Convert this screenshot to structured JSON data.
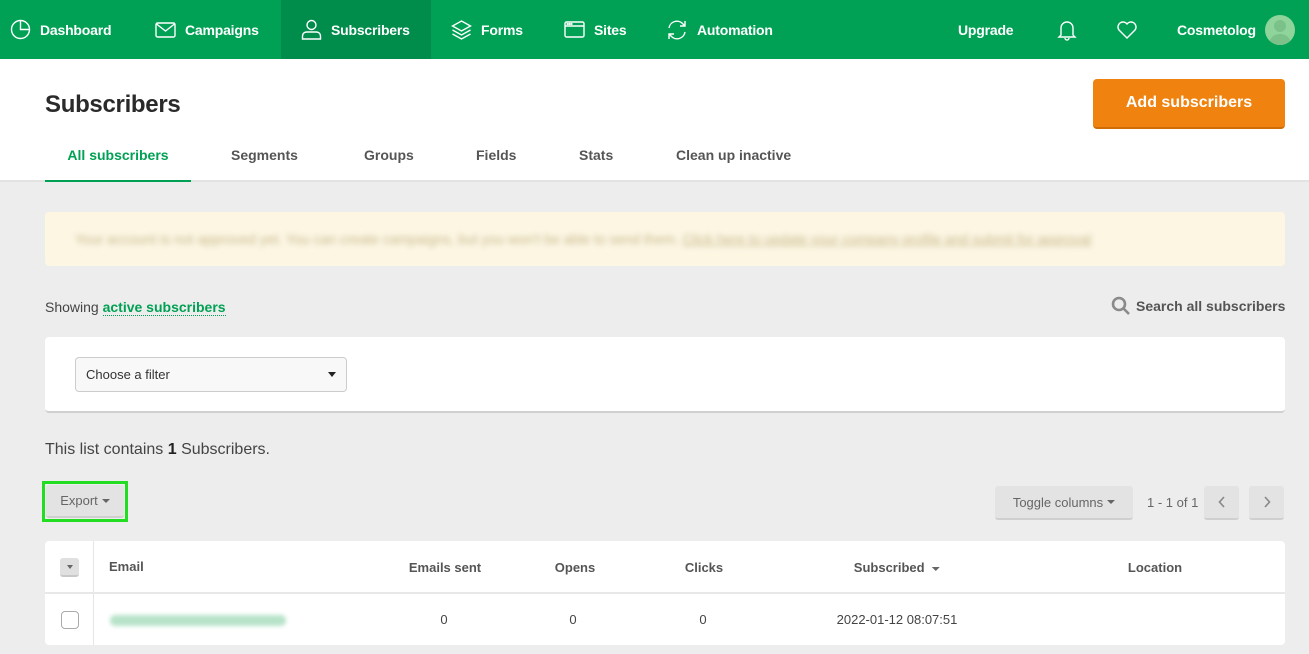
{
  "nav": {
    "items": [
      {
        "label": "Dashboard",
        "icon": "pie-chart-icon",
        "active": false
      },
      {
        "label": "Campaigns",
        "icon": "envelope-icon",
        "active": false
      },
      {
        "label": "Subscribers",
        "icon": "user-icon",
        "active": true
      },
      {
        "label": "Forms",
        "icon": "layers-icon",
        "active": false
      },
      {
        "label": "Sites",
        "icon": "browser-window-icon",
        "active": false
      },
      {
        "label": "Automation",
        "icon": "refresh-icon",
        "active": false
      }
    ],
    "upgrade_label": "Upgrade",
    "notifications_icon": "bell-icon",
    "favorites_icon": "heart-icon",
    "account_name": "Cosmetolog",
    "avatar_icon": "user-avatar-icon"
  },
  "header": {
    "title": "Subscribers",
    "add_button_label": "Add subscribers",
    "tabs": [
      {
        "label": "All subscribers",
        "active": true
      },
      {
        "label": "Segments",
        "active": false
      },
      {
        "label": "Groups",
        "active": false
      },
      {
        "label": "Fields",
        "active": false
      },
      {
        "label": "Stats",
        "active": false
      },
      {
        "label": "Clean up inactive",
        "active": false
      }
    ]
  },
  "notice": {
    "text": "Your account is not approved yet. You can create campaigns, but you won't be able to send them.",
    "link": "Click here to update your company profile and submit for approval"
  },
  "filter_bar": {
    "showing_prefix": "Showing",
    "showing_link": "active subscribers",
    "search_label": "Search all subscribers",
    "filter_placeholder": "Choose a filter"
  },
  "list": {
    "count_prefix": "This list contains",
    "count": "1",
    "count_suffix": "Subscribers.",
    "export_label": "Export",
    "toggle_columns_label": "Toggle columns",
    "pagination": "1 - 1 of 1",
    "prev_icon": "chevron-left-icon",
    "next_icon": "chevron-right-icon"
  },
  "table": {
    "columns": [
      "Email",
      "Emails sent",
      "Opens",
      "Clicks",
      "Subscribed",
      "Location"
    ],
    "sorted_column": "Subscribed",
    "rows": [
      {
        "email": "[redacted email]",
        "emails_sent": "0",
        "opens": "0",
        "clicks": "0",
        "subscribed": "2022-01-12 08:07:51",
        "location": ""
      }
    ]
  },
  "colors": {
    "brand_green": "#00a154",
    "active_nav": "#008c4a",
    "accent_orange": "#f0830f",
    "highlight_border": "#22dd22"
  }
}
